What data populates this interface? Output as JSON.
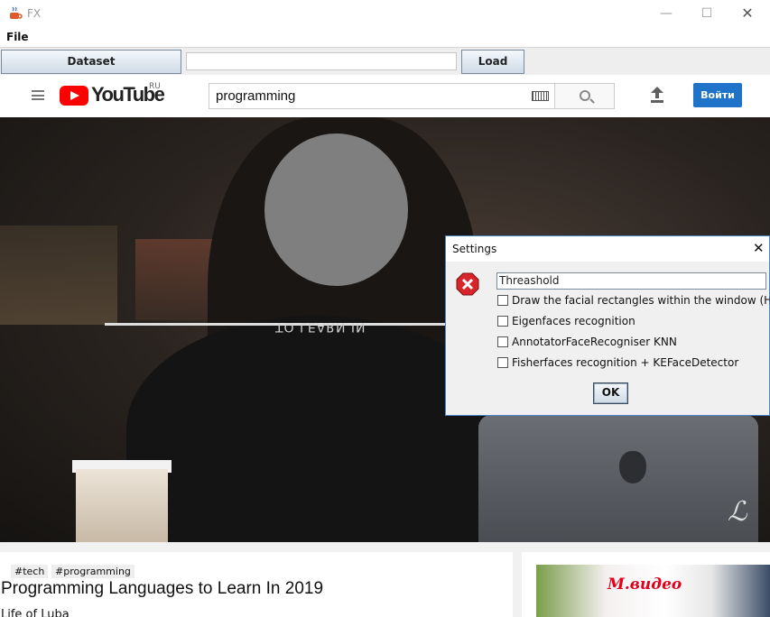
{
  "window": {
    "title": "FX",
    "min_symbol": "—",
    "max_symbol": "☐",
    "close_symbol": "✕"
  },
  "menu": {
    "file_label": "File"
  },
  "toolbar": {
    "dataset_label": "Dataset",
    "path_value": "",
    "load_label": "Load"
  },
  "youtube": {
    "logo_text": "YouTube",
    "region": "RU",
    "search_value": "programming",
    "login_label": "Войти",
    "video": {
      "overlay_text": "TO LEARN IN",
      "signature": "ℒ"
    },
    "tags": [
      "#tech",
      "#programming"
    ],
    "video_title": "Programming Languages to Learn In 2019",
    "channel": "Life of Luba",
    "ad": {
      "brand": "М.видео",
      "small_text": ""
    }
  },
  "dialog": {
    "title": "Settings",
    "close_symbol": "✕",
    "threshold_value": "Threashold",
    "options": [
      {
        "label": "Draw the facial rectangles within the window (Haar)",
        "checked": false
      },
      {
        "label": "Eigenfaces recognition",
        "checked": false
      },
      {
        "label": "AnnotatorFaceRecogniser KNN",
        "checked": false
      },
      {
        "label": "Fisherfaces recognition + KEFaceDetector",
        "checked": false
      }
    ],
    "ok_label": "OK"
  },
  "colors": {
    "accent": "#4a87c8",
    "youtube_red": "#ff0000",
    "login_blue": "#1f74c9",
    "error_red": "#d8252b"
  }
}
